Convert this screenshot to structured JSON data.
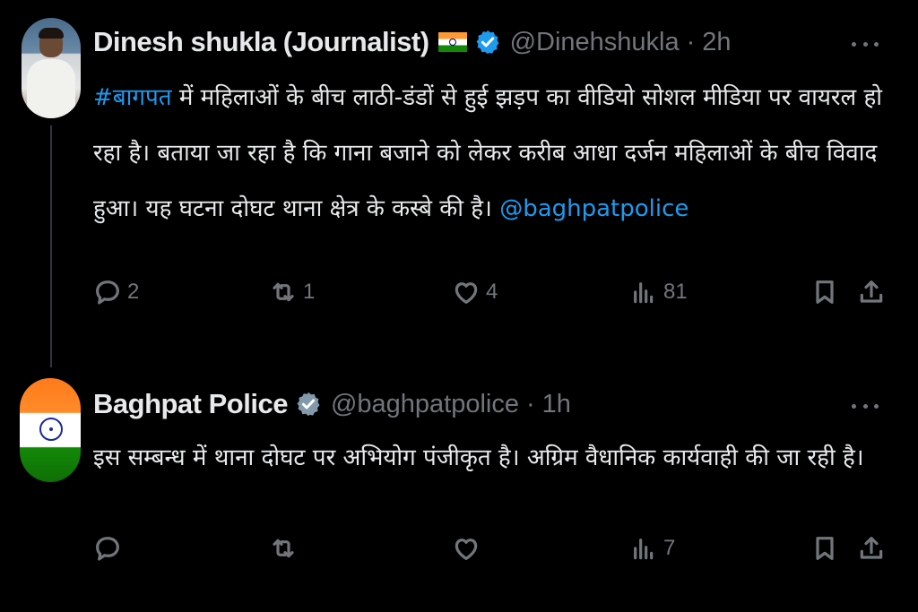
{
  "tweets": [
    {
      "author_name": "Dinesh shukla (Journalist)",
      "handle": "@Dinehshukla",
      "separator": "·",
      "time": "2h",
      "flag_icon": "india-flag-icon",
      "hashtag": "#बागपत",
      "text_part1": " में महिलाओं के बीच लाठी-डंडों से हुई झड़प का वीडियो सोशल मीडिया पर वायरल हो रहा है। बताया जा रहा है कि गाना बजाने को लेकर करीब आधा दर्जन महिलाओं के बीच विवाद हुआ। यह घटना दोघट थाना क्षेत्र के कस्बे की है। ",
      "mention": "@baghpatpolice",
      "actions": {
        "reply_count": "2",
        "retweet_count": "1",
        "like_count": "4",
        "views_count": "81"
      }
    },
    {
      "author_name": "Baghpat Police",
      "handle": "@baghpatpolice",
      "separator": "·",
      "time": "1h",
      "text": "इस सम्बन्ध में थाना दोघट पर अभियोग पंजीकृत है। अग्रिम वैधानिक कार्यवाही की जा रही है।",
      "actions": {
        "reply_count": "",
        "retweet_count": "",
        "like_count": "",
        "views_count": "7"
      }
    }
  ],
  "colors": {
    "background": "#000000",
    "text_primary": "#e7e9ea",
    "text_secondary": "#71767b",
    "link_blue": "#1d9bf0",
    "verified_blue": "#1d9bf0",
    "verified_gray": "#829aab"
  }
}
